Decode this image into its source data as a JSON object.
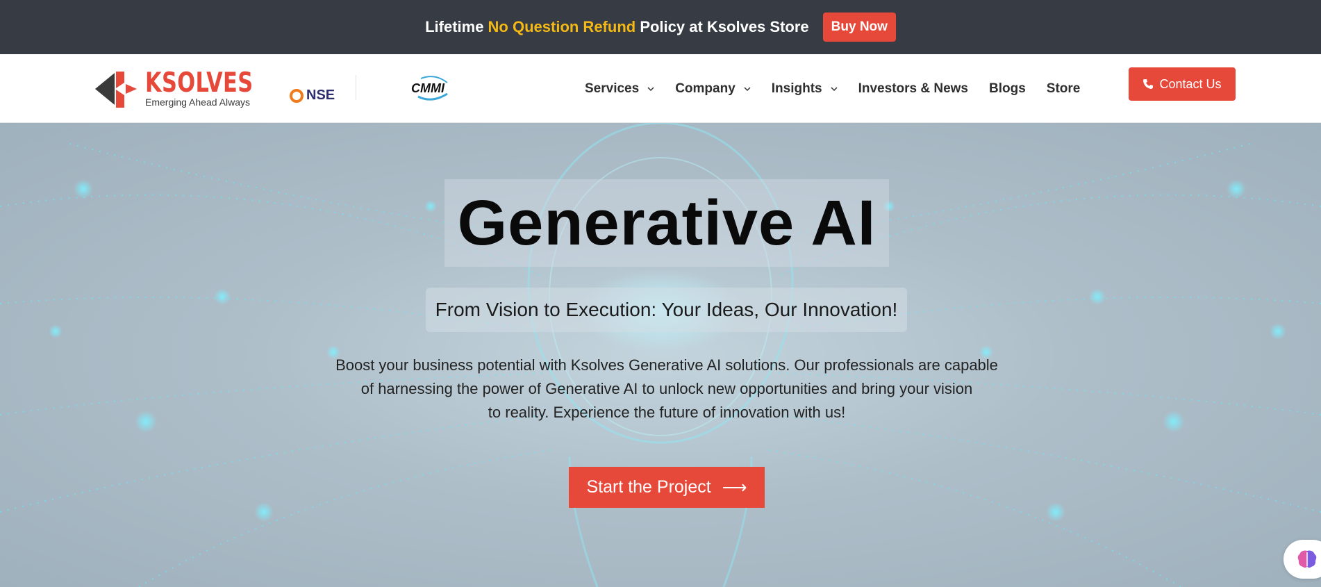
{
  "promo": {
    "text_before": "Lifetime ",
    "highlight": "No Question Refund",
    "text_after": " Policy at Ksolves Store",
    "button_label": "Buy Now"
  },
  "header": {
    "logo_name": "KSOLVES",
    "logo_tagline": "Emerging Ahead Always",
    "nse_label": "NSE",
    "cmmi_label": "CMMI",
    "nav": [
      {
        "label": "Services",
        "has_dropdown": true
      },
      {
        "label": "Company",
        "has_dropdown": true
      },
      {
        "label": "Insights",
        "has_dropdown": true
      },
      {
        "label": "Investors & News",
        "has_dropdown": false
      },
      {
        "label": "Blogs",
        "has_dropdown": false
      },
      {
        "label": "Store",
        "has_dropdown": false
      }
    ],
    "contact_label": "Contact Us"
  },
  "hero": {
    "title": "Generative AI",
    "subtitle": "From Vision to Execution: Your Ideas, Our Innovation!",
    "description_lines": [
      "Boost your business potential with Ksolves Generative AI solutions. Our professionals are capable",
      "of harnessing the power of Generative AI to unlock new opportunities and bring your vision",
      "to reality. Experience the future of innovation with us!"
    ],
    "cta_label": "Start the Project",
    "cta_arrow": "⟶"
  },
  "colors": {
    "accent": "#e6483a",
    "promo_bg": "#363b44",
    "highlight": "#f5b915"
  },
  "icons": [
    "ksolves-logo-icon",
    "nse-logo-icon",
    "cmmi-logo-icon",
    "chevron-down-icon",
    "phone-icon",
    "arrow-right-icon",
    "brain-chat-icon"
  ]
}
